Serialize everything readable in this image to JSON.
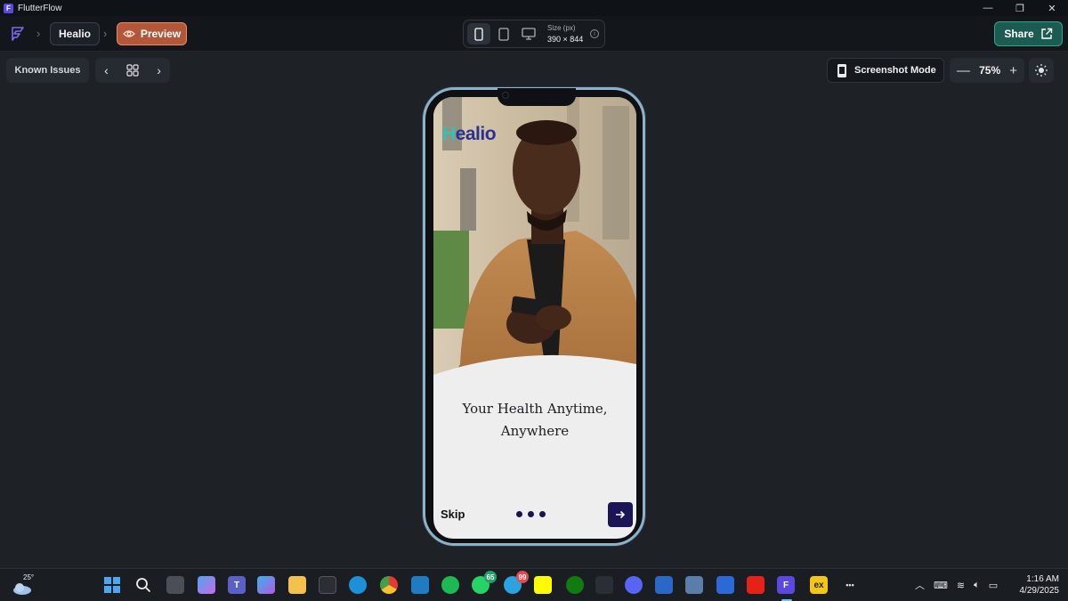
{
  "window": {
    "title": "FlutterFlow",
    "minimize": "—",
    "maximize": "❐",
    "close": "✕"
  },
  "toolbar": {
    "project_name": "Healio",
    "preview_label": "Preview",
    "size_label": "Size (px)",
    "size_value": "390 × 844",
    "share_label": "Share"
  },
  "subbar": {
    "known_issues_label": "Known Issues",
    "screenshot_mode_label": "Screenshot Mode",
    "zoom_level": "75%",
    "zoom_minus": "—",
    "zoom_plus": "+"
  },
  "app_screen": {
    "brand_letter": "H",
    "brand_rest": "ealio",
    "headline_line1": "Your Health Anytime,",
    "headline_line2": "Anywhere",
    "skip_label": "Skip",
    "page_dots": 3
  },
  "taskbar": {
    "weather_temp": "25°",
    "whatsapp_badge": "65",
    "telegram_badge": "99",
    "expressvpn_text": "ex",
    "more_text": "•••",
    "time": "1:16 AM",
    "date": "4/29/2025"
  },
  "colors": {
    "accent_preview": "#b3573a",
    "share_green": "#1b5b52",
    "brand_navy": "#2a3190",
    "brand_teal": "#2cc6b3",
    "button_navy": "#1b1556"
  }
}
